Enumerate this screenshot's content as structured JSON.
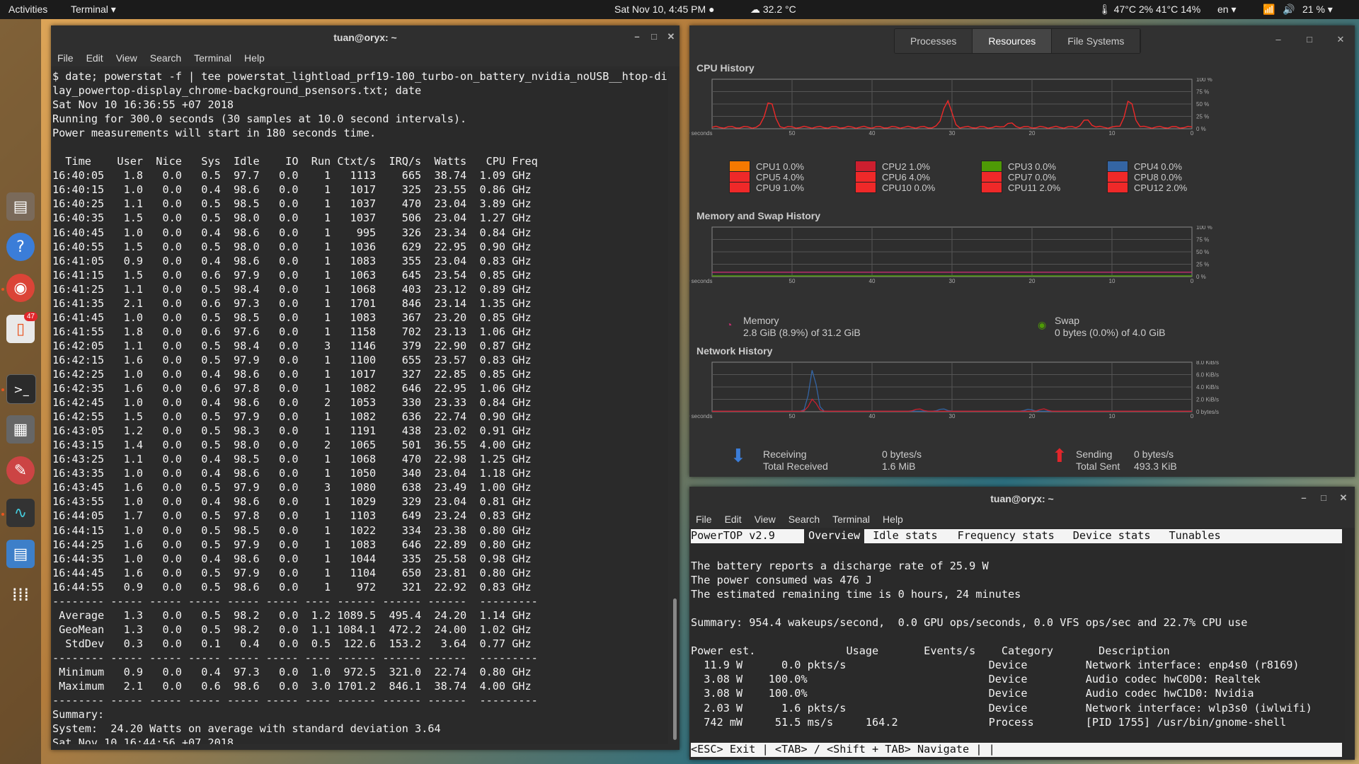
{
  "topbar": {
    "activities": "Activities",
    "app_menu": "Terminal ▾",
    "clock": "Sat Nov 10,  4:45 PM ●",
    "weather": "☁ 32.2 °C",
    "sensors": "🌡 47°C 2% 41°C 14%",
    "keyboard": "en ▾",
    "battery": "21 % ▾"
  },
  "dock": {
    "items": [
      "files-icon",
      "help-icon",
      "chrome-icon",
      "software-icon",
      "terminal-icon",
      "calculator-icon",
      "settings-icon",
      "system-monitor-icon",
      "text-editor-icon",
      "apps-grid-icon"
    ],
    "badge": "47"
  },
  "terminal": {
    "title": "tuan@oryx: ~",
    "menu": [
      "File",
      "Edit",
      "View",
      "Search",
      "Terminal",
      "Help"
    ],
    "lines": [
      "$ date; powerstat -f | tee powerstat_lightload_prf19-100_turbo-on_battery_nvidia_noUSB__htop-disp",
      "lay_powertop-display_chrome-background_psensors.txt; date",
      "Sat Nov 10 16:36:55 +07 2018",
      "Running for 300.0 seconds (30 samples at 10.0 second intervals).",
      "Power measurements will start in 180 seconds time.",
      "",
      "  Time    User  Nice   Sys  Idle    IO  Run Ctxt/s  IRQ/s  Watts   CPU Freq",
      "16:40:05   1.8   0.0   0.5  97.7   0.0    1   1113    665  38.74  1.09 GHz",
      "16:40:15   1.0   0.0   0.4  98.6   0.0    1   1017    325  23.55  0.86 GHz",
      "16:40:25   1.1   0.0   0.5  98.5   0.0    1   1037    470  23.04  3.89 GHz",
      "16:40:35   1.5   0.0   0.5  98.0   0.0    1   1037    506  23.04  1.27 GHz",
      "16:40:45   1.0   0.0   0.4  98.6   0.0    1    995    326  23.34  0.84 GHz",
      "16:40:55   1.5   0.0   0.5  98.0   0.0    1   1036    629  22.95  0.90 GHz",
      "16:41:05   0.9   0.0   0.4  98.6   0.0    1   1083    355  23.04  0.83 GHz",
      "16:41:15   1.5   0.0   0.6  97.9   0.0    1   1063    645  23.54  0.85 GHz",
      "16:41:25   1.1   0.0   0.5  98.4   0.0    1   1068    403  23.12  0.89 GHz",
      "16:41:35   2.1   0.0   0.6  97.3   0.0    1   1701    846  23.14  1.35 GHz",
      "16:41:45   1.0   0.0   0.5  98.5   0.0    1   1083    367  23.20  0.85 GHz",
      "16:41:55   1.8   0.0   0.6  97.6   0.0    1   1158    702  23.13  1.06 GHz",
      "16:42:05   1.1   0.0   0.5  98.4   0.0    3   1146    379  22.90  0.87 GHz",
      "16:42:15   1.6   0.0   0.5  97.9   0.0    1   1100    655  23.57  0.83 GHz",
      "16:42:25   1.0   0.0   0.4  98.6   0.0    1   1017    327  22.85  0.85 GHz",
      "16:42:35   1.6   0.0   0.6  97.8   0.0    1   1082    646  22.95  1.06 GHz",
      "16:42:45   1.0   0.0   0.4  98.6   0.0    2   1053    330  23.33  0.84 GHz",
      "16:42:55   1.5   0.0   0.5  97.9   0.0    1   1082    636  22.74  0.90 GHz",
      "16:43:05   1.2   0.0   0.5  98.3   0.0    1   1191    438  23.02  0.91 GHz",
      "16:43:15   1.4   0.0   0.5  98.0   0.0    2   1065    501  36.55  4.00 GHz",
      "16:43:25   1.1   0.0   0.4  98.5   0.0    1   1068    470  22.98  1.25 GHz",
      "16:43:35   1.0   0.0   0.4  98.6   0.0    1   1050    340  23.04  1.18 GHz",
      "16:43:45   1.6   0.0   0.5  97.9   0.0    3   1080    638  23.49  1.00 GHz",
      "16:43:55   1.0   0.0   0.4  98.6   0.0    1   1029    329  23.04  0.81 GHz",
      "16:44:05   1.7   0.0   0.5  97.8   0.0    1   1103    649  23.24  0.83 GHz",
      "16:44:15   1.0   0.0   0.5  98.5   0.0    1   1022    334  23.38  0.80 GHz",
      "16:44:25   1.6   0.0   0.5  97.9   0.0    1   1083    646  22.89  0.80 GHz",
      "16:44:35   1.0   0.0   0.4  98.6   0.0    1   1044    335  25.58  0.98 GHz",
      "16:44:45   1.6   0.0   0.5  97.9   0.0    1   1104    650  23.81  0.80 GHz",
      "16:44:55   0.9   0.0   0.5  98.6   0.0    1    972    321  22.92  0.83 GHz",
      "-------- ----- ----- ----- ----- ----- ---- ------ ------ ------  ---------",
      " Average   1.3   0.0   0.5  98.2   0.0  1.2 1089.5  495.4  24.20  1.14 GHz",
      " GeoMean   1.3   0.0   0.5  98.2   0.0  1.1 1084.1  472.2  24.00  1.02 GHz",
      "  StdDev   0.3   0.0   0.1   0.4   0.0  0.5  122.6  153.2   3.64  0.77 GHz",
      "-------- ----- ----- ----- ----- ----- ---- ------ ------ ------  ---------",
      " Minimum   0.9   0.0   0.4  97.3   0.0  1.0  972.5  321.0  22.74  0.80 GHz",
      " Maximum   2.1   0.0   0.6  98.6   0.0  3.0 1701.2  846.1  38.74  4.00 GHz",
      "-------- ----- ----- ----- ----- ----- ---- ------ ------ ------  ---------",
      "Summary:",
      "System:  24.20 Watts on average with standard deviation 3.64",
      "Sat Nov 10 16:44:56 +07 2018"
    ]
  },
  "sysmon": {
    "tabs": [
      "Processes",
      "Resources",
      "File Systems"
    ],
    "cpu_title": "CPU History",
    "mem_title": "Memory and Swap History",
    "net_title": "Network History",
    "x_ticks": [
      "60 seconds",
      "50",
      "40",
      "30",
      "20",
      "10",
      "0"
    ],
    "pct_ticks": [
      "100 %",
      "75 %",
      "50 %",
      "25 %",
      "0 %"
    ],
    "net_ticks": [
      "8.0 KiB/s",
      "6.0 KiB/s",
      "4.0 KiB/s",
      "2.0 KiB/s",
      "0 bytes/s"
    ],
    "cpus": [
      {
        "label": "CPU1 0.0%",
        "color": "#f57900"
      },
      {
        "label": "CPU2 1.0%",
        "color": "#cc1f2f"
      },
      {
        "label": "CPU3 0.0%",
        "color": "#4e9a06"
      },
      {
        "label": "CPU4 0.0%",
        "color": "#3465a4"
      },
      {
        "label": "CPU5 4.0%",
        "color": "#ef2929"
      },
      {
        "label": "CPU6 4.0%",
        "color": "#ef2929"
      },
      {
        "label": "CPU7 0.0%",
        "color": "#ef2929"
      },
      {
        "label": "CPU8 0.0%",
        "color": "#ef2929"
      },
      {
        "label": "CPU9 1.0%",
        "color": "#ef2929"
      },
      {
        "label": "CPU10 0.0%",
        "color": "#ef2929"
      },
      {
        "label": "CPU11 2.0%",
        "color": "#ef2929"
      },
      {
        "label": "CPU12 2.0%",
        "color": "#ef2929"
      }
    ],
    "memory": {
      "label": "Memory",
      "value": "2.8 GiB (8.9%) of 31.2 GiB"
    },
    "swap": {
      "label": "Swap",
      "value": "0 bytes (0.0%) of 4.0 GiB"
    },
    "receiving": {
      "label": "Receiving",
      "rate": "0 bytes/s",
      "total_label": "Total Received",
      "total": "1.6 MiB"
    },
    "sending": {
      "label": "Sending",
      "rate": "0 bytes/s",
      "total_label": "Total Sent",
      "total": "493.3 KiB"
    }
  },
  "powertop": {
    "title": "tuan@oryx: ~",
    "menu": [
      "File",
      "Edit",
      "View",
      "Search",
      "Terminal",
      "Help"
    ],
    "version": "PowerTOP v2.9",
    "tabs": [
      "Overview",
      "Idle stats",
      "Frequency stats",
      "Device stats",
      "Tunables"
    ],
    "lines": [
      "",
      "The battery reports a discharge rate of 25.9 W",
      "The power consumed was 476 J",
      "The estimated remaining time is 0 hours, 24 minutes",
      "",
      "Summary: 954.4 wakeups/second,  0.0 GPU ops/seconds, 0.0 VFS ops/sec and 22.7% CPU use",
      "",
      "Power est.              Usage       Events/s    Category       Description",
      "  11.9 W      0.0 pkts/s                      Device         Network interface: enp4s0 (r8169)",
      "  3.08 W    100.0%                            Device         Audio codec hwC0D0: Realtek",
      "  3.08 W    100.0%                            Device         Audio codec hwC1D0: Nvidia",
      "  2.03 W      1.6 pkts/s                      Device         Network interface: wlp3s0 (iwlwifi)",
      "  742 mW     51.5 ms/s     164.2              Process        [PID 1755] /usr/bin/gnome-shell"
    ],
    "footer": "<ESC> Exit | <TAB> / <Shift + TAB> Navigate | |"
  }
}
